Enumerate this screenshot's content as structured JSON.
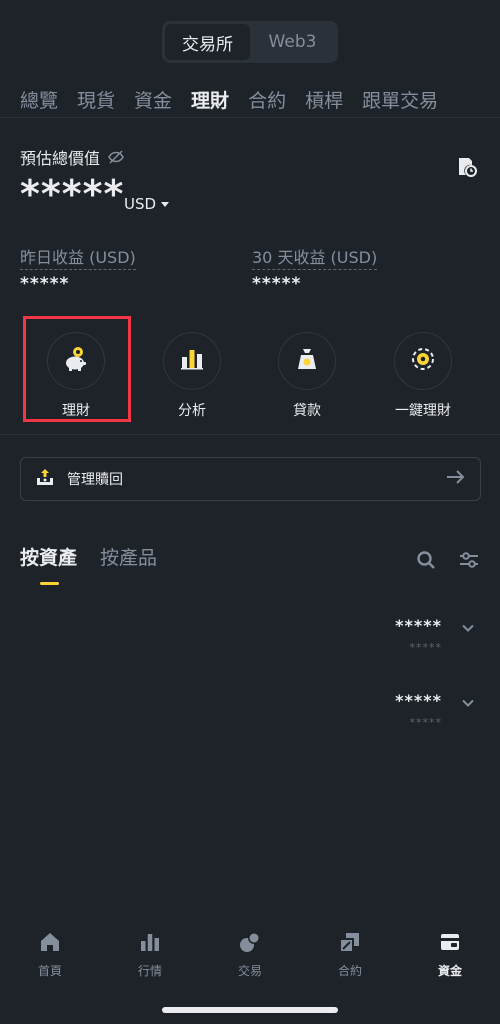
{
  "switch": {
    "items": [
      "交易所",
      "Web3"
    ],
    "active_index": 0
  },
  "category_tabs": [
    "總覽",
    "現貨",
    "資金",
    "理財",
    "合約",
    "槓桿",
    "跟單交易"
  ],
  "category_active_index": 3,
  "balance": {
    "label": "預估總價值",
    "masked_value": "*****",
    "currency": "USD"
  },
  "earnings": {
    "yesterday_label": "昨日收益 (USD)",
    "yesterday_value": "*****",
    "days30_label": "30 天收益 (USD)",
    "days30_value": "*****"
  },
  "actions": [
    {
      "label": "理財",
      "icon": "piggy-bank-icon"
    },
    {
      "label": "分析",
      "icon": "bar-chart-icon"
    },
    {
      "label": "貸款",
      "icon": "loan-bag-icon"
    },
    {
      "label": "一鍵理財",
      "icon": "one-click-earn-icon"
    }
  ],
  "manage_button": {
    "label": "管理贖回",
    "icon": "redeem-icon"
  },
  "asset_tabs": [
    "按資產",
    "按產品"
  ],
  "asset_active_index": 0,
  "asset_rows": [
    {
      "value": "*****",
      "sub": "*****"
    },
    {
      "value": "*****",
      "sub": "*****"
    }
  ],
  "bottom_nav": [
    {
      "label": "首頁",
      "icon": "home-icon"
    },
    {
      "label": "行情",
      "icon": "markets-icon"
    },
    {
      "label": "交易",
      "icon": "trade-icon"
    },
    {
      "label": "合約",
      "icon": "futures-icon"
    },
    {
      "label": "資金",
      "icon": "wallet-icon"
    }
  ],
  "bottom_nav_active_index": 4,
  "colors": {
    "background": "#1e2329",
    "accent": "#fcd535",
    "highlight": "#f23645",
    "muted": "#848e9c"
  }
}
